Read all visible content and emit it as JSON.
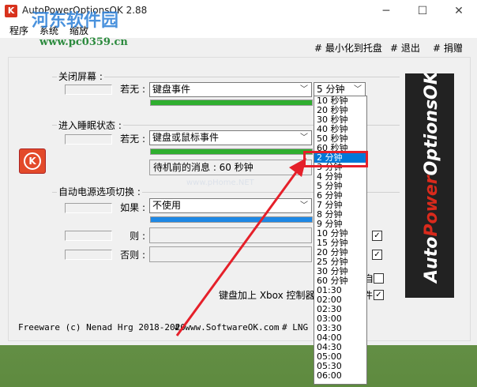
{
  "window": {
    "title": "AutoPowerOptionsOK 2.88",
    "min": "─",
    "max": "☐",
    "close": "✕"
  },
  "menu": [
    "程序",
    "系统",
    "缩放"
  ],
  "watermark": {
    "line1": "河东软件园",
    "line2": "www.pc0359.cn",
    "center": "www.pHome.NET"
  },
  "toolbar": {
    "minimize": "# 最小化到托盘",
    "exit": "# 退出",
    "donate": "# 捐赠"
  },
  "screen_off": {
    "group": "关闭屏幕 :",
    "cond_label": "若无 :",
    "event": "键盘事件",
    "time": "5 分钟",
    "progress": 1.0
  },
  "sleep": {
    "group": "进入睡眠状态 :",
    "cond_label": "若无 :",
    "event": "键盘或鼠标事件",
    "progress": 1.0,
    "message": "待机前的消息 : 60 秒钟"
  },
  "auto_switch": {
    "group": "自动电源选项切换 :",
    "if_label": "如果 :",
    "if_value": "不使用",
    "then_label": "则 :",
    "else_label": "否则 :",
    "progress": 1.0,
    "check1": "✓",
    "check2": "✓",
    "suffix3": "自",
    "suffix4": "件",
    "check4": "✓"
  },
  "keyboard_xbox": "键盘加上 Xbox 控制器",
  "banner": {
    "part1": "Auto",
    "part2": "Power",
    "part3": "OptionsOK"
  },
  "status": {
    "freeware": "Freeware (c) Nenad Hrg 2018-2020",
    "site": "# www.SoftwareOK.com",
    "lng": "# LNG"
  },
  "dropdown_items": [
    "10 秒钟",
    "20 秒钟",
    "30 秒钟",
    "40 秒钟",
    "50 秒钟",
    "60 秒钟",
    "2 分钟",
    "3 分钟",
    "4 分钟",
    "5 分钟",
    "6 分钟",
    "7 分钟",
    "8 分钟",
    "9 分钟",
    "10 分钟",
    "15 分钟",
    "20 分钟",
    "25 分钟",
    "30 分钟",
    "60 分钟",
    "01:30",
    "02:00",
    "02:30",
    "03:00",
    "03:30",
    "04:00",
    "04:30",
    "05:00",
    "05:30",
    "06:00"
  ],
  "dropdown_selected_index": 6
}
